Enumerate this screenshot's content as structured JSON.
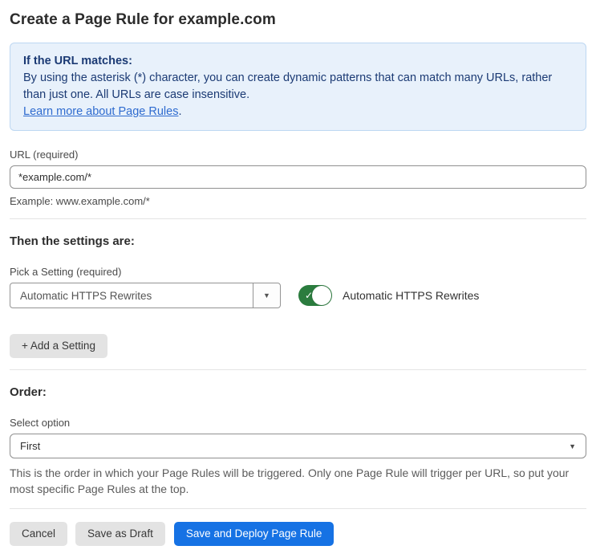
{
  "page": {
    "title": "Create a Page Rule for example.com"
  },
  "info_box": {
    "heading": "If the URL matches:",
    "body": "By using the asterisk (*) character, you can create dynamic patterns that can match many URLs, rather than just one. All URLs are case insensitive.",
    "link": "Learn more about Page Rules",
    "link_suffix": "."
  },
  "url_field": {
    "label": "URL (required)",
    "value": "*example.com/*",
    "hint": "Example: www.example.com/*"
  },
  "settings": {
    "heading": "Then the settings are:",
    "picker_label": "Pick a Setting (required)",
    "selected_setting": "Automatic HTTPS Rewrites",
    "dropdown_arrow": "▼",
    "toggle_state": "on",
    "toggle_check": "✓",
    "toggle_label": "Automatic HTTPS Rewrites",
    "add_setting_label": "+ Add a Setting"
  },
  "order": {
    "heading": "Order:",
    "select_label": "Select option",
    "selected_option": "First",
    "select_arrow": "▼",
    "help": "This is the order in which your Page Rules will be triggered. Only one Page Rule will trigger per URL, so put your most specific Page Rules at the top."
  },
  "footer": {
    "cancel_label": "Cancel",
    "save_draft_label": "Save as Draft",
    "save_deploy_label": "Save and Deploy Page Rule"
  },
  "colors": {
    "accent_blue": "#1672e4",
    "info_background": "#e8f1fb",
    "info_border": "#bdd7f2",
    "info_text": "#1b3a74",
    "link_blue": "#2e6bcf",
    "toggle_green": "#2b7c3e"
  }
}
